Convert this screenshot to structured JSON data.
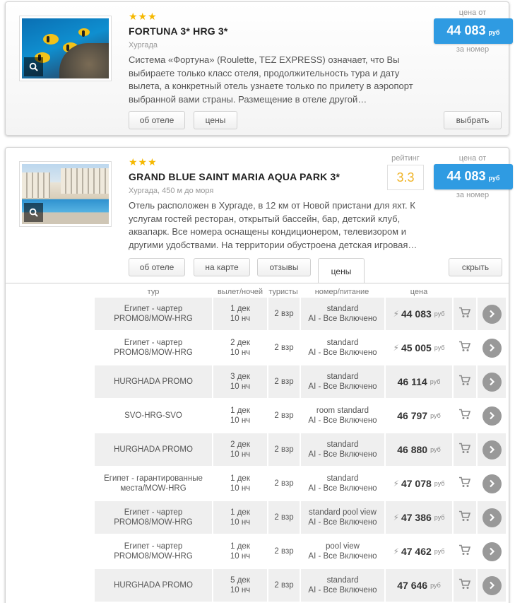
{
  "currency": "руб",
  "hotels": [
    {
      "stars": "★★★",
      "name": "FORTUNA 3* HRG 3*",
      "location": "Хургада",
      "description": "Система «Фортуна» (Roulette, TEZ EXPRESS) означает, что Вы выбираете только класс отеля, продолжительность тура и дату вылета, а конкретный отель узнаете только по прилету в аэропорт выбранной вами страны. Размещение в отеле другой…",
      "price_from_label": "цена от",
      "price": "44 083",
      "per_room_label": "за номер",
      "buttons": {
        "about": "об отеле",
        "prices": "цены",
        "select": "выбрать"
      }
    },
    {
      "stars": "★★★",
      "name": "GRAND BLUE SAINT MARIA AQUA PARK 3*",
      "location": "Хургада, 450 м до моря",
      "description": "Отель расположен в Хургаде, в 12 км от Новой пристани для яхт. К услугам гостей ресторан, открытый бассейн, бар, детский клуб, аквапарк. Все номера оснащены кондиционером, телевизором и другими удобствами. На территории обустроена детская игровая…",
      "rating_label": "рейтинг",
      "rating": "3.3",
      "price_from_label": "цена от",
      "price": "44 083",
      "per_room_label": "за номер",
      "buttons": {
        "about": "об отеле",
        "map": "на карте",
        "reviews": "отзывы",
        "prices": "цены",
        "hide": "скрыть"
      }
    }
  ],
  "table": {
    "headers": {
      "tour": "тур",
      "departure": "вылет/ночей",
      "tourists": "туристы",
      "room": "номер/питание",
      "price": "цена"
    },
    "rows": [
      {
        "tour": [
          "Египет - чартер",
          "PROMO8/MOW-HRG"
        ],
        "date": "1 дек",
        "nights": "10 нч",
        "tourists": "2 взр",
        "room": "standard",
        "meal": "AI - Все Включено",
        "bolt": true,
        "price": "44 083",
        "shade": true
      },
      {
        "tour": [
          "Египет - чартер",
          "PROMO8/MOW-HRG"
        ],
        "date": "2 дек",
        "nights": "10 нч",
        "tourists": "2 взр",
        "room": "standard",
        "meal": "AI - Все Включено",
        "bolt": true,
        "price": "45 005",
        "shade": false
      },
      {
        "tour": [
          "HURGHADA PROMO"
        ],
        "date": "3 дек",
        "nights": "10 нч",
        "tourists": "2 взр",
        "room": "standard",
        "meal": "AI - Все Включено",
        "bolt": false,
        "price": "46 114",
        "shade": true
      },
      {
        "tour": [
          "SVO-HRG-SVO"
        ],
        "date": "1 дек",
        "nights": "10 нч",
        "tourists": "2 взр",
        "room": "room standard",
        "meal": "AI - Все Включено",
        "bolt": false,
        "price": "46 797",
        "shade": false
      },
      {
        "tour": [
          "HURGHADA PROMO"
        ],
        "date": "2 дек",
        "nights": "10 нч",
        "tourists": "2 взр",
        "room": "standard",
        "meal": "AI - Все Включено",
        "bolt": false,
        "price": "46 880",
        "shade": true
      },
      {
        "tour": [
          "Египет - гарантированные",
          "места/MOW-HRG"
        ],
        "date": "1 дек",
        "nights": "10 нч",
        "tourists": "2 взр",
        "room": "standard",
        "meal": "AI - Все Включено",
        "bolt": true,
        "price": "47 078",
        "shade": false
      },
      {
        "tour": [
          "Египет - чартер",
          "PROMO8/MOW-HRG"
        ],
        "date": "1 дек",
        "nights": "10 нч",
        "tourists": "2 взр",
        "room": "standard pool view",
        "meal": "AI - Все Включено",
        "bolt": true,
        "price": "47 386",
        "shade": true
      },
      {
        "tour": [
          "Египет - чартер",
          "PROMO8/MOW-HRG"
        ],
        "date": "1 дек",
        "nights": "10 нч",
        "tourists": "2 взр",
        "room": "pool view",
        "meal": "AI - Все Включено",
        "bolt": true,
        "price": "47 462",
        "shade": false
      },
      {
        "tour": [
          "HURGHADA PROMO"
        ],
        "date": "5 дек",
        "nights": "10 нч",
        "tourists": "2 взр",
        "room": "standard",
        "meal": "AI - Все Включено",
        "bolt": false,
        "price": "47 646",
        "shade": true
      }
    ]
  },
  "icons": {
    "zoom": "magnifier-icon",
    "cart": "cart-icon",
    "go": "chevron-right-icon",
    "bolt": "lightning-icon"
  },
  "colors": {
    "accent": "#2f9be2",
    "stars": "#f5b800",
    "rating": "#f0b429"
  }
}
